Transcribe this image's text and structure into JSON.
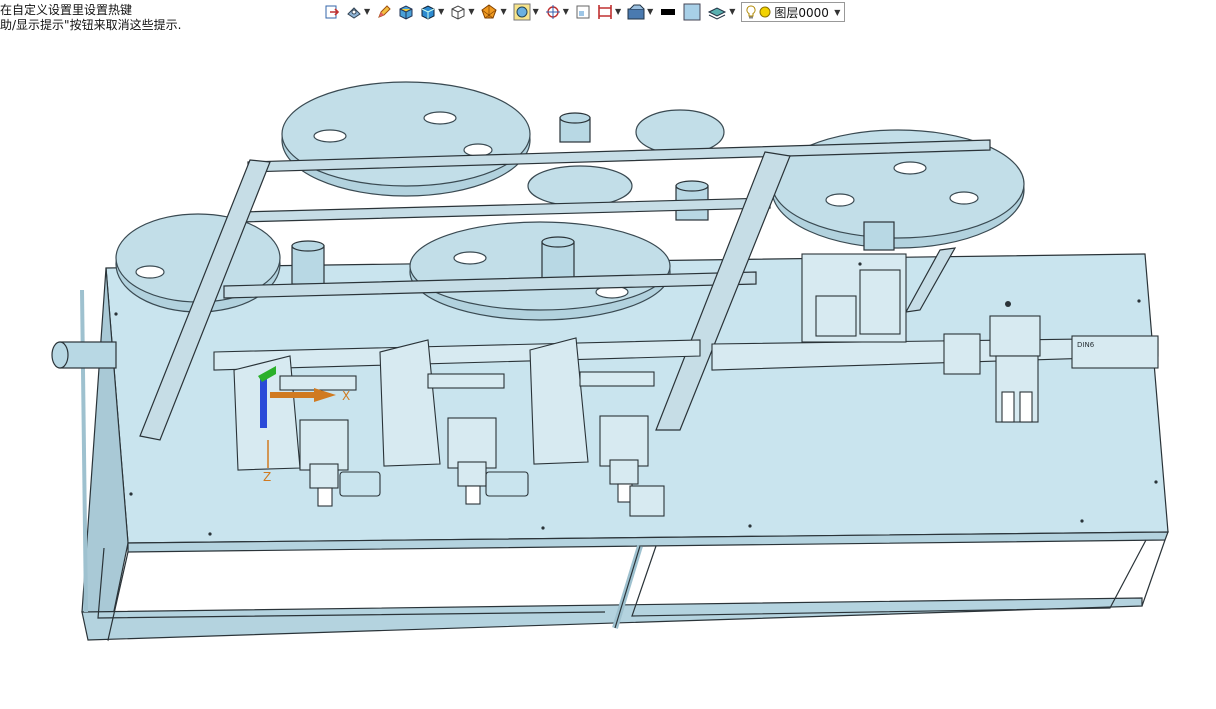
{
  "hints": {
    "line1": "在自定义设置里设置热键",
    "line2": "助/显示提示\"按钮来取消这些提示."
  },
  "toolbar": {
    "items": [
      {
        "icon": "exit-icon",
        "has_dropdown": false
      },
      {
        "icon": "view-orient-icon",
        "has_dropdown": true
      },
      {
        "icon": "pencil-icon",
        "has_dropdown": false
      },
      {
        "icon": "shaded-box-icon",
        "has_dropdown": false
      },
      {
        "icon": "solid-cube-icon",
        "has_dropdown": true
      },
      {
        "icon": "wireframe-cube-icon",
        "has_dropdown": true
      },
      {
        "icon": "polygon-icon",
        "has_dropdown": true
      },
      {
        "icon": "box-display-icon",
        "has_dropdown": true
      },
      {
        "icon": "target-icon",
        "has_dropdown": true
      },
      {
        "icon": "frame-icon",
        "has_dropdown": false
      },
      {
        "icon": "dimension-icon",
        "has_dropdown": true
      },
      {
        "icon": "render-icon",
        "has_dropdown": true
      },
      {
        "icon": "line-color-icon",
        "has_dropdown": false
      },
      {
        "icon": "face-color-icon",
        "has_dropdown": false
      },
      {
        "icon": "layer-stack-icon",
        "has_dropdown": true
      }
    ],
    "layer": {
      "value": "图层0000"
    }
  },
  "colors": {
    "body": "#c9e4ee",
    "body_dark": "#a9c9d6",
    "frame": "#b4d3df",
    "reel": "#b2d2de",
    "reel_edge": "#3a4a52",
    "outline": "#2a3338",
    "axis_x": "#d07a20",
    "axis_y": "#2ab02a",
    "axis_z": "#2a4ad8"
  },
  "axes": {
    "x_label": "X",
    "z_label": "Z"
  },
  "label_plate": "DIN6"
}
